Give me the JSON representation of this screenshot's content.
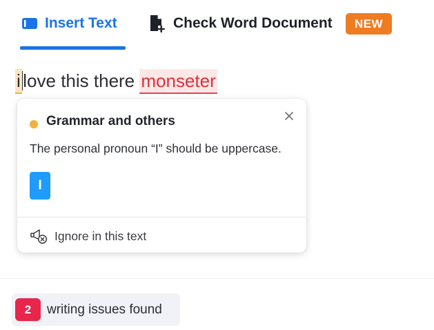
{
  "tabs": [
    {
      "label": "Insert Text",
      "icon": "keyboard-icon",
      "active": true
    },
    {
      "label": "Check Word Document",
      "icon": "document-add-icon",
      "active": false
    }
  ],
  "badge": {
    "new_label": "NEW"
  },
  "editor": {
    "tokens": [
      {
        "text": "i",
        "status": "grammar"
      },
      {
        "text": "love this there",
        "status": "ok"
      },
      {
        "text": "monseter",
        "status": "spelling"
      }
    ]
  },
  "suggestion_card": {
    "category": "Grammar and others",
    "message": "The personal pronoun “I” should be uppercase.",
    "replacement": "I",
    "ignore_label": "Ignore in this text"
  },
  "status": {
    "issue_count": "2",
    "issue_label": "writing issues found"
  },
  "colors": {
    "accent": "#1a73e8",
    "badge_new": "#f07c22",
    "grammar_marker": "#f2b13d",
    "spelling_marker": "#e8424e",
    "suggestion_button": "#1f9bff",
    "issue_count_badge": "#e8264c"
  }
}
